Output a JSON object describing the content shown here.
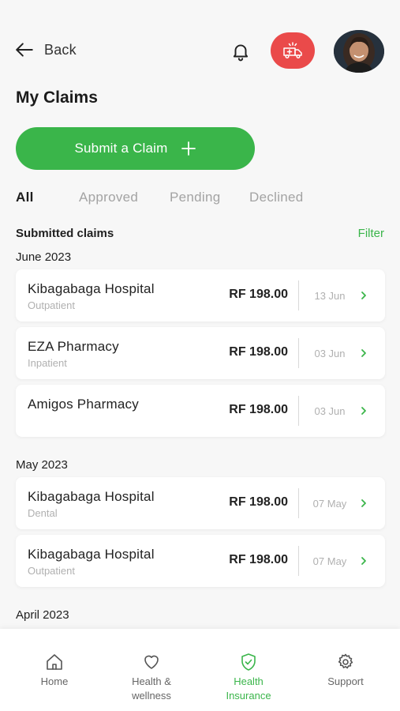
{
  "header": {
    "back_label": "Back",
    "title": "My Claims",
    "icons": [
      "bell-icon",
      "ambulance-icon",
      "avatar"
    ]
  },
  "submit_button": {
    "label": "Submit a Claim"
  },
  "tabs": [
    {
      "label": "All",
      "active": true
    },
    {
      "label": "Approved",
      "active": false
    },
    {
      "label": "Pending",
      "active": false
    },
    {
      "label": "Declined",
      "active": false
    }
  ],
  "list": {
    "heading": "Submitted claims",
    "filter_label": "Filter",
    "groups": [
      {
        "month": "June 2023",
        "claims": [
          {
            "provider": "Kibagabaga Hospital",
            "type": "Outpatient",
            "amount": "RF 198.00",
            "date": "13 Jun"
          },
          {
            "provider": "EZA Pharmacy",
            "type": "Inpatient",
            "amount": "RF 198.00",
            "date": "03 Jun"
          },
          {
            "provider": "Amigos Pharmacy",
            "type": "",
            "amount": "RF 198.00",
            "date": "03 Jun"
          }
        ]
      },
      {
        "month": "May 2023",
        "claims": [
          {
            "provider": "Kibagabaga Hospital",
            "type": "Dental",
            "amount": "RF 198.00",
            "date": "07 May"
          },
          {
            "provider": "Kibagabaga Hospital",
            "type": "Outpatient",
            "amount": "RF 198.00",
            "date": "07 May"
          }
        ]
      },
      {
        "month": "April 2023",
        "claims": []
      }
    ]
  },
  "bottom_nav": [
    {
      "label": "Home",
      "icon": "home-icon",
      "active": false
    },
    {
      "label": "Health &\nwellness",
      "icon": "heart-icon",
      "active": false
    },
    {
      "label": "Health\nInsurance",
      "icon": "shield-check-icon",
      "active": true
    },
    {
      "label": "Support",
      "icon": "gear-icon",
      "active": false
    }
  ],
  "colors": {
    "accent": "#3ab54a",
    "emergency": "#ea4a4a",
    "muted": "#a3a3a3",
    "background": "#f7f7f7"
  }
}
